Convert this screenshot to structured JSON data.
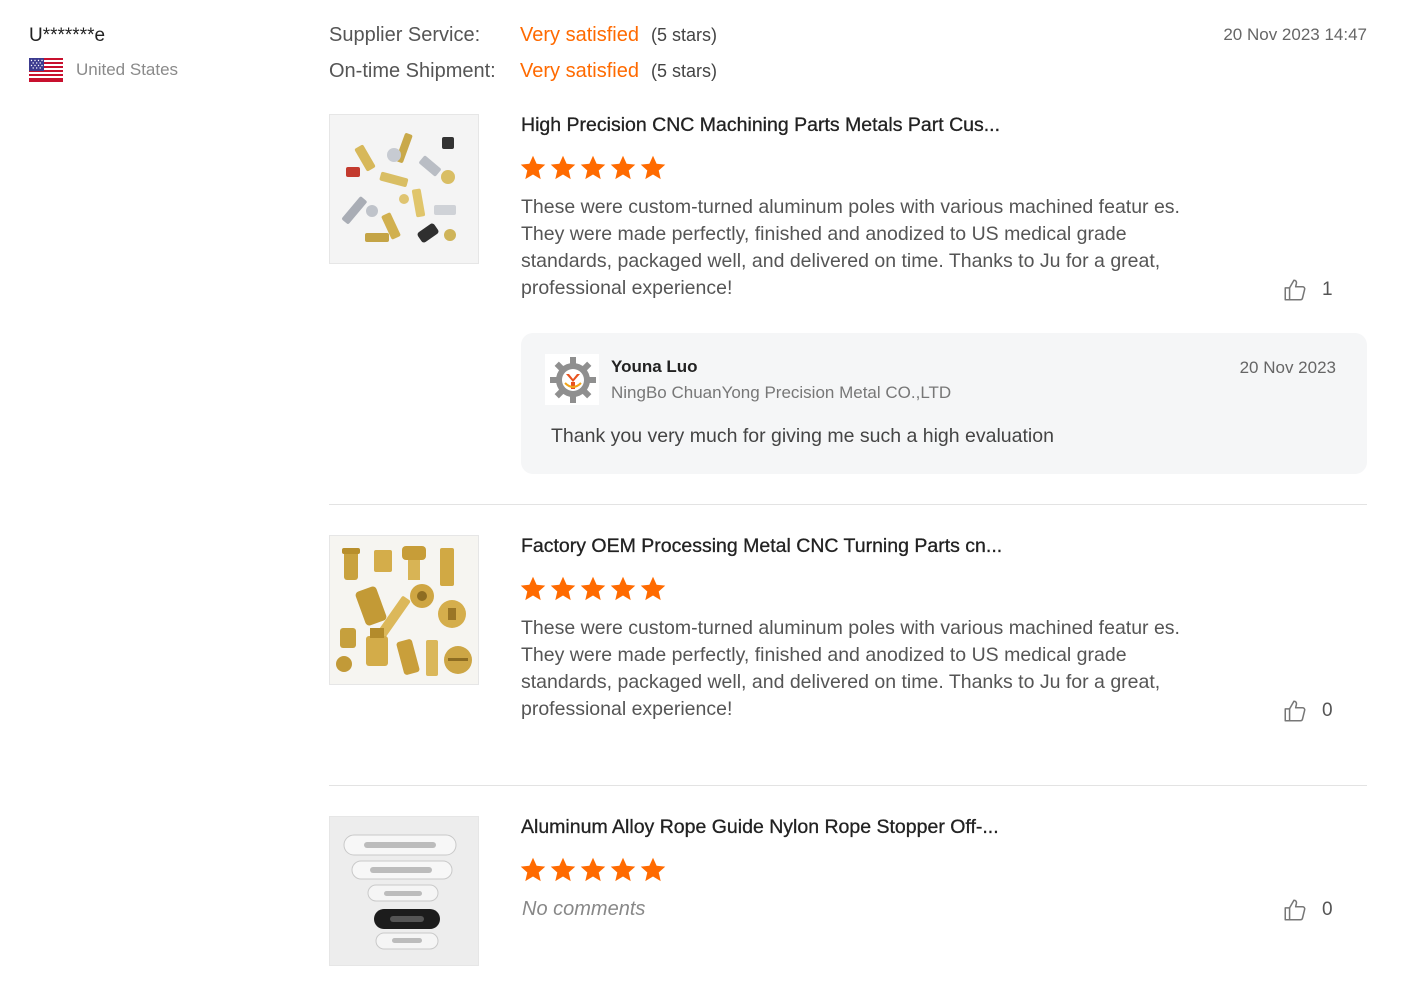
{
  "reviewer": {
    "name": "U*******e",
    "country": "United States",
    "flag_icon": "us-flag-icon"
  },
  "ratings": [
    {
      "label": "Supplier Service:",
      "value": "Very satisfied",
      "stars": "(5 stars)"
    },
    {
      "label": "On-time Shipment:",
      "value": "Very satisfied",
      "stars": "(5 stars)"
    }
  ],
  "review_date": "20 Nov 2023 14:47",
  "colors": {
    "accent": "#ff6a00",
    "star": "#ff6a00",
    "reply_bg": "#f5f6f7"
  },
  "products": [
    {
      "title": "High Precision CNC Machining Parts Metals Part Cus...",
      "rating": 5,
      "text": "These were custom-turned aluminum poles with various machined featur es. They were made perfectly, finished and anodized to US medical grade standards, packaged well, and delivered on time. Thanks to Ju for a great, professional experience!",
      "likes": "1"
    },
    {
      "title": "Factory OEM Processing Metal CNC Turning Parts cn...",
      "rating": 5,
      "text": "These were custom-turned aluminum poles with various machined featur es. They were made perfectly, finished and anodized to US medical grade standards, packaged well, and delivered on time. Thanks to Ju for a great, professional experience!",
      "likes": "0"
    },
    {
      "title": "Aluminum Alloy Rope Guide Nylon Rope Stopper Off-...",
      "rating": 5,
      "text": "No comments",
      "likes": "0"
    }
  ],
  "reply": {
    "name": "Youna Luo",
    "company": "NingBo ChuanYong Precision Metal CO.,LTD",
    "date": "20 Nov 2023",
    "text": "Thank you very much for giving me such a high evaluation"
  }
}
